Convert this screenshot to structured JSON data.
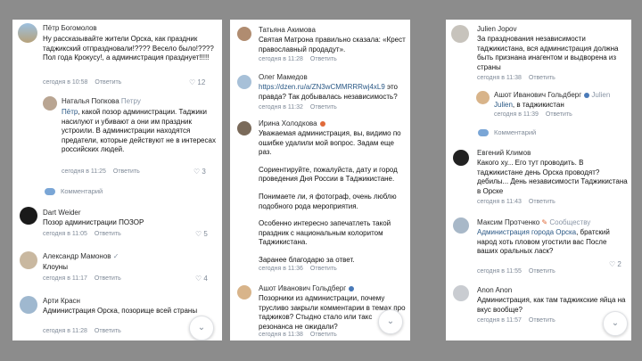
{
  "col1": {
    "c1": {
      "name": "Пётр Богомолов",
      "text": "Ну рассказывайте жители Орска, как праздник таджикский отпраздновали!???? Весело было!???? Пол года Крокусу!, а администрация празднует!!!!!",
      "time": "сегодня в 10:58",
      "reply": "Ответить",
      "likes": "12"
    },
    "r1": {
      "name": "Наталья Попкова",
      "reply_to": "Петру",
      "mention": "Пётр",
      "text": ", какой позор администрации. Таджики насилуют и убивают а они им праздник устроили. В администрации находятся предатели, которые действуют не в интересах российских людей.",
      "time": "сегодня в 11:25",
      "reply": "Ответить",
      "likes": "3"
    },
    "more": "Комментарий",
    "c2": {
      "name": "Dart Weider",
      "text": "Позор администрации ПОЗОР",
      "time": "сегодня в 11:05",
      "reply": "Ответить",
      "likes": "5"
    },
    "c3": {
      "name": "Александр Мамонов",
      "text": "Клоуны",
      "time": "сегодня в 11:17",
      "reply": "Ответить",
      "likes": "4"
    },
    "c4": {
      "name": "Арти Красн",
      "text": "Администрация Орска, позорище всей страны",
      "time": "сегодня в 11:28",
      "reply": "Ответить"
    }
  },
  "col2": {
    "c1": {
      "name": "Татьяна Акимова",
      "text": "Святая Матрона правильно сказала: «Крест православный продадут».",
      "time": "сегодня в 11:28",
      "reply": "Ответить"
    },
    "c2": {
      "name": "Олег Мамедов",
      "link": "https://dzen.ru/a/ZN3wCMMRRRwj4xL9",
      "text": " это правда? Так добывалась независимость?",
      "time": "сегодня в 11:32",
      "reply": "Ответить"
    },
    "c3": {
      "name": "Ирина Холодкова",
      "p1": "Уважаемая администрация, вы, видимо по ошибке удалили мой вопрос. Задам еще раз.",
      "p2": "Сориентируйте, пожалуйста, дату и город проведения Дня России в Таджикистане.",
      "p3": "Понимаете ли, я фотограф, очень люблю подобного рода мероприятия.",
      "p4": "Особенно интересно запечатлеть такой праздник с национальным колоритом Таджикистана.",
      "p5": "Заранее благодарю за ответ.",
      "time": "сегодня в 11:36",
      "reply": "Ответить"
    },
    "c4": {
      "name": "Ашот Иванович Гольдберг",
      "text": "Позорники из администрации, почему трусливо закрыли комментарии в темах про таджиков? Стыдно стало или такс резонанса не ожидали?",
      "time": "сегодня в 11:38",
      "reply": "Ответить"
    }
  },
  "col3": {
    "c1": {
      "name": "Julien Jopov",
      "text": "За празднования независимости таджикистана, вся администрация должна быть признана инагентом и выдворена из страны",
      "time": "сегодня в 11:38",
      "reply": "Ответить"
    },
    "r1": {
      "name": "Ашот Иванович Гольдберг",
      "reply_to": "Julien",
      "mention": "Julien",
      "text": ", в таджикистан",
      "time": "сегодня в 11:39",
      "reply": "Ответить"
    },
    "more": "Комментарий",
    "c2": {
      "name": "Евгений Климов",
      "text": "Какого ху... Его тут проводить. В таджикистане день Орска проводят? дебилы... День независимости Таджикистана в Орске",
      "time": "сегодня в 11:43",
      "reply": "Ответить"
    },
    "c3": {
      "name": "Максим Протченко",
      "community": "Сообществу",
      "mention": "Администрация города Орска",
      "text": ", братский народ хоть пловом угостили вас После ваших оральных ласк?",
      "time": "сегодня в 11:55",
      "reply": "Ответить",
      "likes": "2"
    },
    "c4": {
      "name": "Anon Anon",
      "text": "Администрация, как там таджикские яйца на вкус вообще?",
      "time": "сегодня в 11:57",
      "reply": "Ответить"
    }
  },
  "icons": {
    "scroll_down": "chevron-down-icon",
    "like": "heart-icon",
    "verified": "check-icon"
  }
}
